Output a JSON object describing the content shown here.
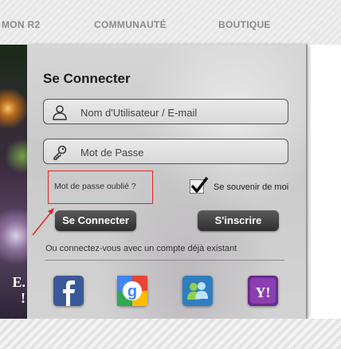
{
  "nav": {
    "items": [
      {
        "label": "MON R2"
      },
      {
        "label": "COMMUNAUTÉ"
      },
      {
        "label": "BOUTIQUE"
      }
    ]
  },
  "hero": {
    "line1": "E.",
    "line2": "!"
  },
  "login": {
    "title": "Se Connecter",
    "username_placeholder": "Nom d'Utilisateur / E-mail",
    "password_placeholder": "Mot de Passe",
    "forgot_label": "Mot de passe oublié ?",
    "remember_label": "Se souvenir de moi",
    "remember_checked": true,
    "login_button": "Se Connecter",
    "register_button": "S'inscrire",
    "alt_text": "Ou connectez-vous avec un compte déjà existant"
  },
  "social": {
    "providers": [
      {
        "name": "facebook-icon",
        "color": "#3b5998",
        "glyph": "f"
      },
      {
        "name": "google-icon",
        "color": "#ffffff",
        "glyph": "g"
      },
      {
        "name": "messenger-icon",
        "color": "#2f7fbf",
        "glyph": ""
      },
      {
        "name": "yahoo-icon",
        "color": "#6b2a8c",
        "glyph": "Y!"
      }
    ]
  },
  "colors": {
    "highlight_box": "#e0241f",
    "button": "#3a3a3a"
  }
}
